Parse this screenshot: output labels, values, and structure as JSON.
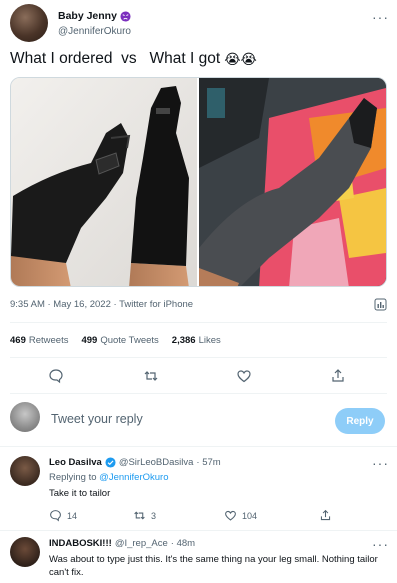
{
  "tweet": {
    "author_name": "Baby Jenny",
    "author_handle": "@JenniferOkuro",
    "text": "What I ordered  vs   What I got",
    "emoji": "😭😭",
    "timestamp": "9:35 AM · May 16, 2022 · Twitter for iPhone",
    "stats": [
      {
        "count": "469",
        "label": "Retweets"
      },
      {
        "count": "499",
        "label": "Quote Tweets"
      },
      {
        "count": "2,386",
        "label": "Likes"
      }
    ]
  },
  "composer": {
    "placeholder": "Tweet your reply",
    "reply_label": "Reply"
  },
  "replies": [
    {
      "name": "Leo Dasilva",
      "handle": "@SirLeoBDasilva",
      "time": "· 57m",
      "replying_prefix": "Replying to",
      "replying_to": "@JenniferOkuro",
      "text": "Take it to tailor",
      "reply_count": "14",
      "retweet_count": "3",
      "like_count": "104"
    },
    {
      "name": "INDABOSKI!!!",
      "handle": "@I_rep_Ace",
      "time": "· 48m",
      "text": "Was about to type just this. It's the same thing na your leg small. Nothing tailor can't fix."
    }
  ],
  "colors": {
    "accent": "#1d9bf0",
    "reply_button_disabled": "#8ecdf8",
    "secondary_text": "#536471"
  }
}
